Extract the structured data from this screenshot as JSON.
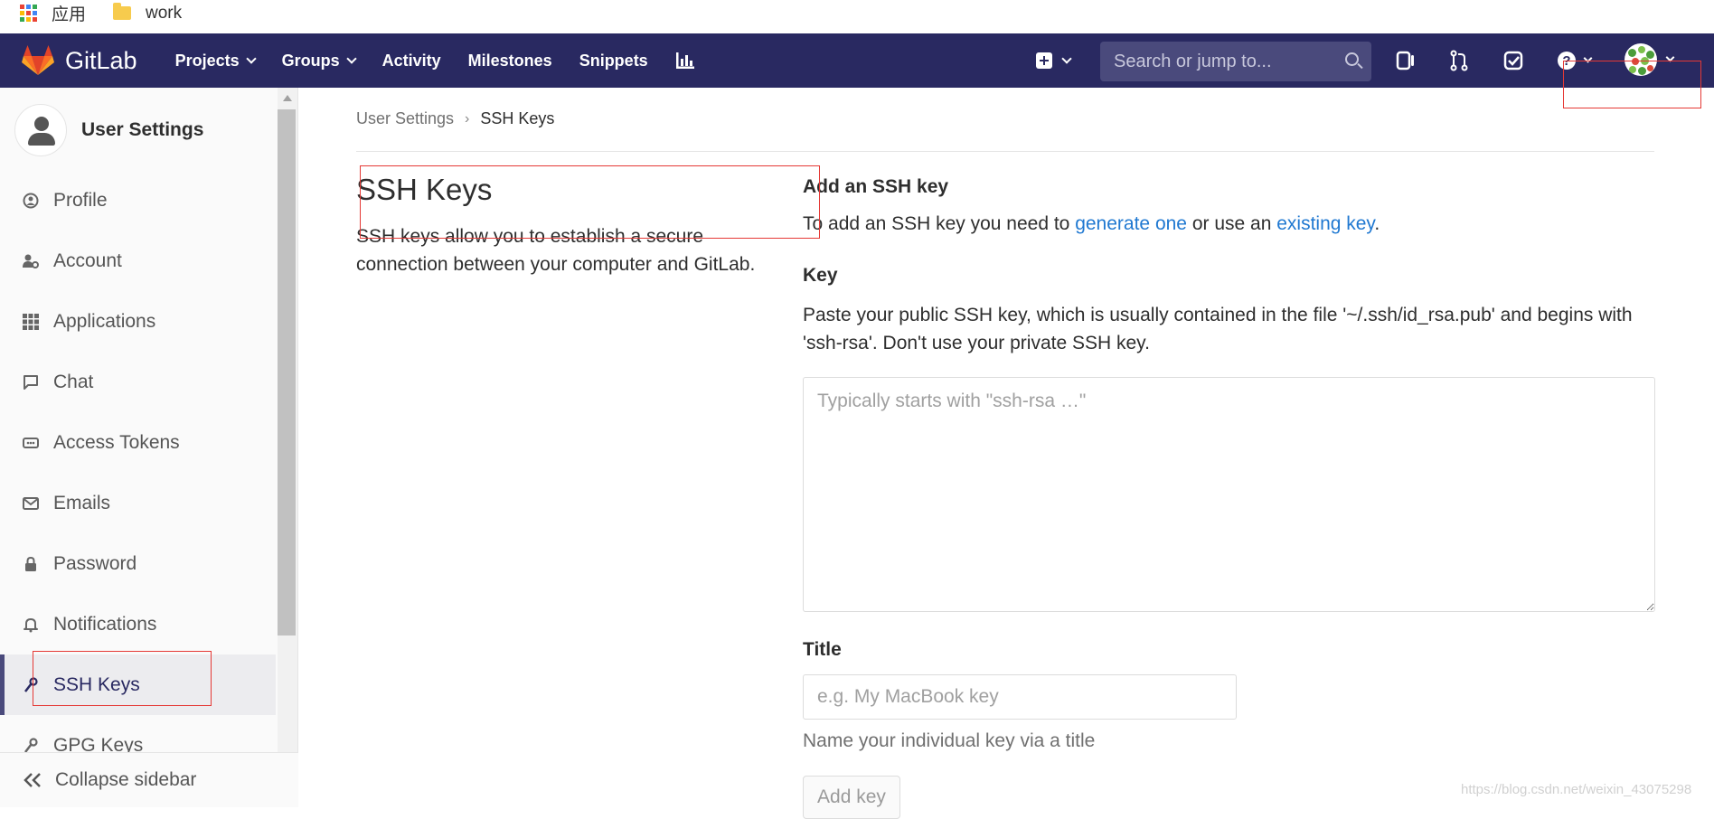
{
  "bookmarks": {
    "items": [
      {
        "label": "应用",
        "icon": "apps-grid-icon"
      },
      {
        "label": "work",
        "icon": "folder-icon"
      }
    ],
    "grid_colors": [
      "#ea4335",
      "#4285f4",
      "#34a853",
      "#fbbc05",
      "#ea4335",
      "#4285f4",
      "#34a853",
      "#fbbc05",
      "#ea4335"
    ]
  },
  "navbar": {
    "brand": "GitLab",
    "links": [
      "Projects",
      "Groups",
      "Activity",
      "Milestones",
      "Snippets"
    ],
    "search_placeholder": "Search or jump to...",
    "bg_color": "#292961"
  },
  "sidebar": {
    "title": "User Settings",
    "items": [
      {
        "label": "Profile",
        "icon": "profile-icon"
      },
      {
        "label": "Account",
        "icon": "account-icon"
      },
      {
        "label": "Applications",
        "icon": "applications-icon"
      },
      {
        "label": "Chat",
        "icon": "chat-icon"
      },
      {
        "label": "Access Tokens",
        "icon": "access-tokens-icon"
      },
      {
        "label": "Emails",
        "icon": "emails-icon"
      },
      {
        "label": "Password",
        "icon": "password-icon"
      },
      {
        "label": "Notifications",
        "icon": "notifications-icon"
      },
      {
        "label": "SSH Keys",
        "icon": "ssh-key-icon",
        "active": true
      },
      {
        "label": "GPG Keys",
        "icon": "gpg-key-icon"
      }
    ],
    "collapse_label": "Collapse sidebar"
  },
  "breadcrumb": {
    "parent": "User Settings",
    "current": "SSH Keys"
  },
  "page": {
    "title": "SSH Keys",
    "description": "SSH keys allow you to establish a secure connection between your computer and GitLab."
  },
  "form": {
    "section_title": "Add an SSH key",
    "intro_before": "To add an SSH key you need to ",
    "intro_link1": "generate one",
    "intro_middle": " or use an ",
    "intro_link2": "existing key",
    "intro_after": ".",
    "key_label": "Key",
    "key_help": "Paste your public SSH key, which is usually contained in the file '~/.ssh/id_rsa.pub' and begins with 'ssh-rsa'. Don't use your private SSH key.",
    "key_placeholder": "Typically starts with \"ssh-rsa …\"",
    "title_label": "Title",
    "title_placeholder": "e.g. My MacBook key",
    "title_help": "Name your individual key via a title",
    "submit_label": "Add key"
  },
  "watermark": "https://blog.csdn.net/weixin_43075298",
  "colors": {
    "link": "#1f78d1",
    "annotation": "#e53935",
    "active_bar": "#4a4a7c"
  }
}
